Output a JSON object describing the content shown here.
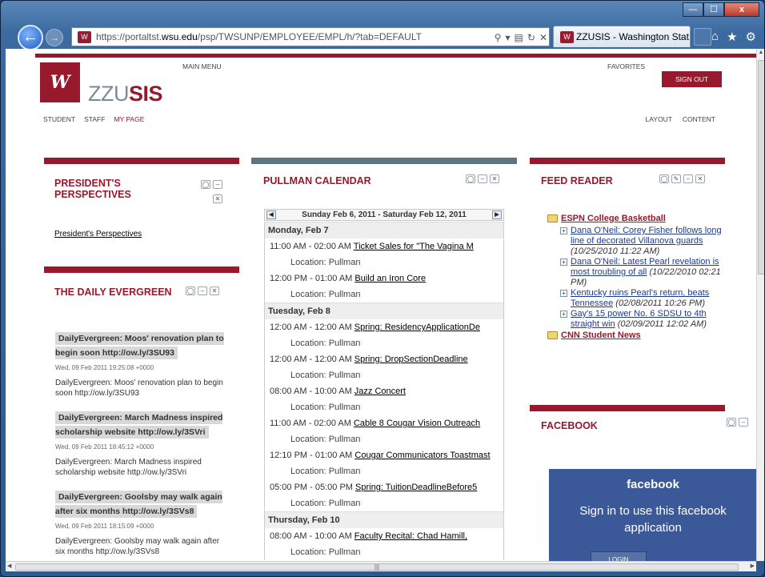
{
  "browser": {
    "url_prefix": "https://portaltst.",
    "url_domain": "wsu.edu",
    "url_suffix": "/psp/TWSUNP/EMPLOYEE/EMPL/h/?tab=DEFAULT",
    "tab_title": "ZZUSIS - Washington Stat...",
    "win_min": "—",
    "win_max": "☐",
    "win_close": "x"
  },
  "header": {
    "brand_prefix": "ZZU",
    "brand_suffix": "SIS",
    "main_menu": "MAIN MENU",
    "favorites": "FAVORITES",
    "sign_out": "SIGN OUT",
    "nav_left": [
      "STUDENT",
      "STAFF",
      "MY PAGE"
    ],
    "nav_right": [
      "LAYOUT",
      "CONTENT"
    ]
  },
  "president": {
    "title_line1": "PRESIDENT'S",
    "title_line2": "PERSPECTIVES",
    "link": "President's Perspectives"
  },
  "evergreen": {
    "title": "THE DAILY EVERGREEN",
    "items": [
      {
        "headline": "DailyEvergreen: Moos' renovation plan to begin soon http://ow.ly/3SU93",
        "date": "Wed, 09 Feb 2011 19:25:08 +0000",
        "text": "DailyEvergreen: Moos' renovation plan to begin soon http://ow.ly/3SU93"
      },
      {
        "headline": "DailyEvergreen: March Madness inspired scholarship website http://ow.ly/3SVri",
        "date": "Wed, 09 Feb 2011 18:45:12 +0000",
        "text": "DailyEvergreen: March Madness inspired scholarship website http://ow.ly/3SVri"
      },
      {
        "headline": "DailyEvergreen: Goolsby may walk again after six months http://ow.ly/3SVs8",
        "date": "Wed, 09 Feb 2011 18:15:09 +0000",
        "text": "DailyEvergreen: Goolsby may walk again after six months http://ow.ly/3SVs8"
      }
    ]
  },
  "calendar": {
    "title": "PULLMAN CALENDAR",
    "range": "Sunday Feb 6, 2011 - Saturday Feb 12, 2011",
    "rows": [
      {
        "kind": "day",
        "text": "Monday, Feb 7"
      },
      {
        "kind": "ev",
        "time": "11:00 AM - 02:00 AM",
        "title": "Ticket Sales for \"The Vagina M"
      },
      {
        "kind": "loc",
        "text": "Location: Pullman"
      },
      {
        "kind": "ev",
        "time": "12:00 PM - 01:00 AM",
        "title": "Build an Iron Core"
      },
      {
        "kind": "loc",
        "text": "Location: Pullman"
      },
      {
        "kind": "day",
        "text": "Tuesday, Feb 8"
      },
      {
        "kind": "ev",
        "time": "12:00 AM - 12:00 AM",
        "title": "Spring: ResidencyApplicationDe"
      },
      {
        "kind": "loc",
        "text": "Location: Pullman"
      },
      {
        "kind": "ev",
        "time": "12:00 AM - 12:00 AM",
        "title": "Spring: DropSectionDeadline"
      },
      {
        "kind": "loc",
        "text": "Location: Pullman"
      },
      {
        "kind": "ev",
        "time": "08:00 AM - 10:00 AM",
        "title": "Jazz Concert"
      },
      {
        "kind": "loc",
        "text": "Location: Pullman"
      },
      {
        "kind": "ev",
        "time": "11:00 AM - 02:00 AM",
        "title": "Cable 8 Cougar Vision Outreach"
      },
      {
        "kind": "loc",
        "text": "Location: Pullman"
      },
      {
        "kind": "ev",
        "time": "12:10 PM - 01:00 AM",
        "title": "Cougar Communicators Toastmast"
      },
      {
        "kind": "loc",
        "text": "Location: Pullman"
      },
      {
        "kind": "ev",
        "time": "05:00 PM - 05:00 PM",
        "title": "Spring: TuitionDeadlineBefore5"
      },
      {
        "kind": "loc",
        "text": "Location: Pullman"
      },
      {
        "kind": "day",
        "text": "Thursday, Feb 10"
      },
      {
        "kind": "ev",
        "time": "08:00 AM - 10:00 AM",
        "title": "Faculty Recital: Chad Hamill,"
      },
      {
        "kind": "loc",
        "text": "Location: Pullman"
      }
    ]
  },
  "feed": {
    "title": "FEED READER",
    "source": "ESPN College Basketball",
    "items": [
      {
        "title": "Dana O'Neil: Corey Fisher follows long line of decorated Villanova guards",
        "date": "(10/25/2010 11:22 AM)"
      },
      {
        "title": "Dana O'Neil: Latest Pearl revelation is most troubling of all",
        "date": "(10/22/2010 02:21 PM)"
      },
      {
        "title": "Kentucky ruins Pearl's return, beats Tennessee",
        "date": "(02/08/2011 10:26 PM)"
      },
      {
        "title": "Gay's 15 power No. 6 SDSU to 4th straight win",
        "date": "(02/09/2011 12:02 AM)"
      }
    ],
    "source2": "CNN Student News"
  },
  "facebook": {
    "title": "FACEBOOK",
    "logo": "facebook",
    "message": "Sign in to use this facebook application",
    "login": "LOGIN"
  }
}
